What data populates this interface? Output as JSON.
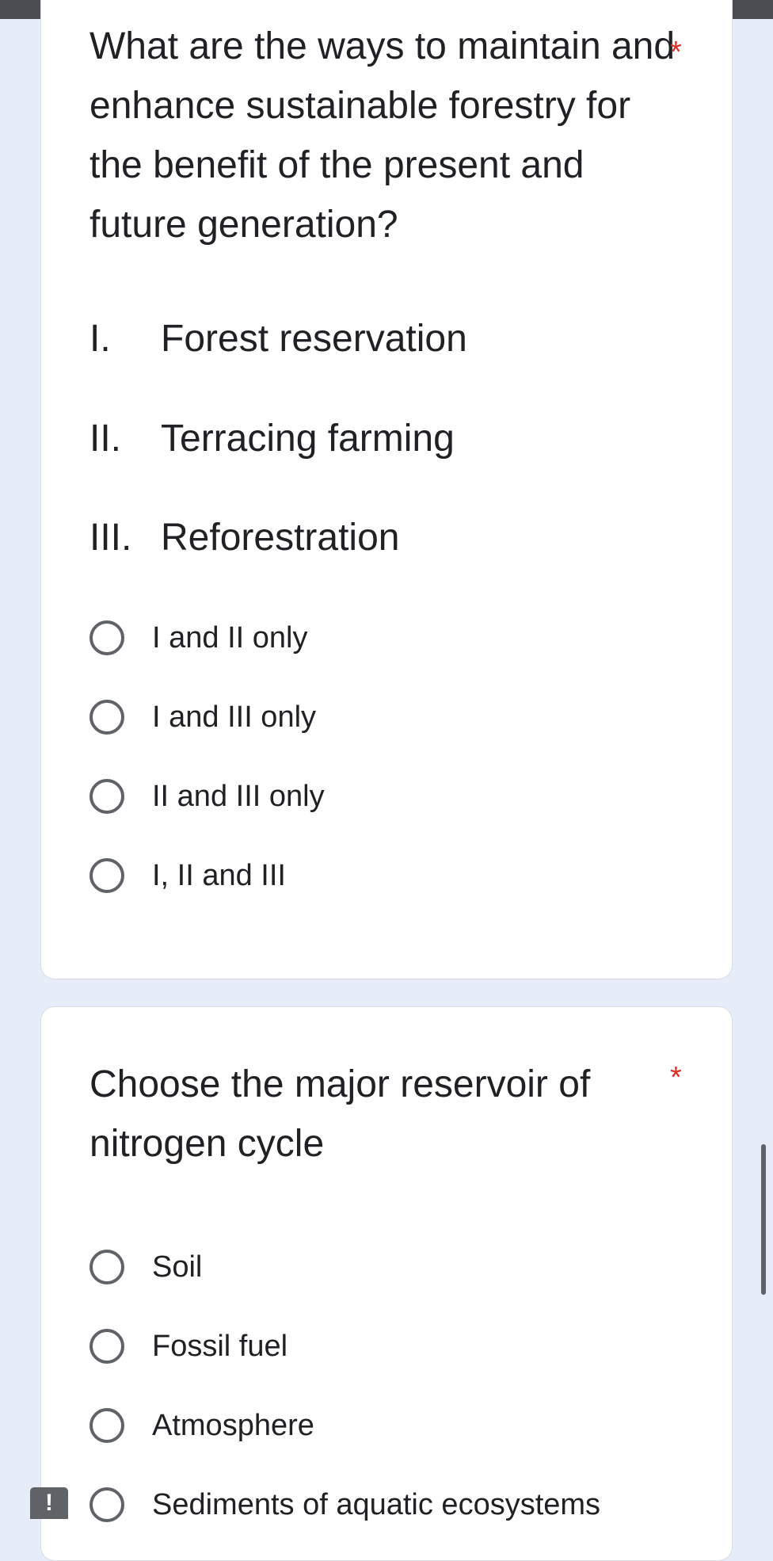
{
  "questions": [
    {
      "title": "What are the ways to maintain and enhance sustainable forestry for the benefit of the present and future generation?",
      "required_mark": "*",
      "statements": [
        {
          "numeral": "I.",
          "text": "Forest reservation"
        },
        {
          "numeral": "II.",
          "text": "Terracing farming"
        },
        {
          "numeral": "III.",
          "text": "Reforestration"
        }
      ],
      "options": [
        "I and II only",
        "I and III only",
        "II and III only",
        "I, II and III"
      ]
    },
    {
      "title": "Choose the major reservoir of nitrogen cycle",
      "required_mark": "*",
      "options": [
        "Soil",
        "Fossil fuel",
        "Atmosphere",
        "Sediments of aquatic ecosystems"
      ]
    }
  ],
  "icons": {
    "radio": "radio-unchecked-icon",
    "feedback": "feedback-icon"
  },
  "colors": {
    "background": "#e6edf8",
    "card": "#ffffff",
    "required": "#d93025",
    "radio_border": "#5f6368",
    "text": "#202124"
  }
}
